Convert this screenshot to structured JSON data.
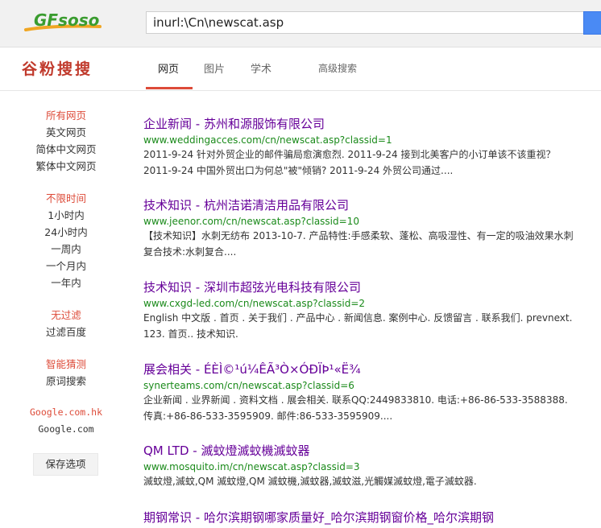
{
  "header": {
    "logo_text": "GFsoso",
    "search_value": "inurl:\\Cn\\newscat.asp"
  },
  "brand": "谷粉搜搜",
  "tabs": [
    "网页",
    "图片",
    "学术",
    "高级搜索"
  ],
  "sidebar": {
    "lang_all": "所有网页",
    "lang_en": "英文网页",
    "lang_zhs": "简体中文网页",
    "lang_zht": "繁体中文网页",
    "time_any": "不限时间",
    "time_1h": "1小时内",
    "time_24h": "24小时内",
    "time_week": "一周内",
    "time_month": "一个月内",
    "time_year": "一年内",
    "filter_none": "无过滤",
    "filter_baidu": "过滤百度",
    "guess_smart": "智能猜测",
    "guess_orig": "原词搜索",
    "google_hk": "Google.com.hk",
    "google_com": "Google.com",
    "save_label": "保存选项"
  },
  "results": [
    {
      "title": "企业新闻 - 苏州和源服饰有限公司",
      "url": "www.weddingacces.com/cn/newscat.asp?classid=1",
      "snippet": "2011-9-24 针对外贸企业的邮件骗局愈演愈烈. 2011-9-24 接到北美客户的小订单该不该重视？ 2011-9-24 中国外贸出口为何总\"被\"倾销? 2011-9-24 外贸公司通过...."
    },
    {
      "title": "技术知识 - 杭州洁诺清洁用品有限公司",
      "url": "www.jeenor.com/cn/newscat.asp?classid=10",
      "snippet": "【技术知识】水刺无纺布 2013-10-7. 产品特性:手感柔软、蓬松、高吸湿性、有一定的吸油效果水刺复合技术:水刺复合...."
    },
    {
      "title": "技术知识 - 深圳市超弦光电科技有限公司",
      "url": "www.cxgd-led.com/cn/newscat.asp?classid=2",
      "snippet": "English 中文版 . 首页 . 关于我们 . 产品中心 . 新闻信息. 案例中心. 反馈留言 . 联系我们. prevnext. 123. 首页.. 技术知识."
    },
    {
      "title": "展会相关 - ÉÈÌ©¹ú¼ÊÃ³Ò×ÓÐÏÞ¹«Ë¾",
      "url": "synerteams.com/cn/newscat.asp?classid=6",
      "snippet": "企业新闻 . 业界新闻 . 资料文档 . 展会相关. 联系QQ:2449833810. 电话:+86-86-533-3588388. 传真:+86-86-533-3595909. 邮件:86-533-3595909...."
    },
    {
      "title": "QM LTD - 滅蚊燈滅蚊機滅蚊器",
      "url": "www.mosquito.im/cn/newscat.asp?classid=3",
      "snippet": "滅蚊燈,滅蚊,QM 滅蚊燈,QM 滅蚊機,滅蚊器,滅蚊滋,光觸媒滅蚊燈,電子滅蚊器."
    },
    {
      "title": "期钢常识 - 哈尔滨期钢哪家质量好_哈尔滨期钢窗价格_哈尔滨期钢",
      "url": "",
      "snippet": ""
    }
  ],
  "colors": {
    "accent_red": "#dd4b39",
    "link_purple": "#660099",
    "url_green": "#1a8a1a",
    "search_blue": "#4a8af4"
  }
}
